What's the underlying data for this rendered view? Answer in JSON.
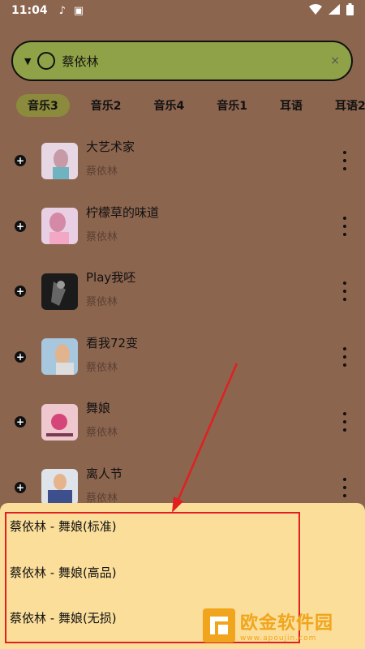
{
  "status_bar": {
    "time": "11:04"
  },
  "search": {
    "query": "蔡依林",
    "clear_icon": "×"
  },
  "tabs": [
    {
      "label": "音乐3",
      "active": true
    },
    {
      "label": "音乐2"
    },
    {
      "label": "音乐4"
    },
    {
      "label": "音乐1"
    },
    {
      "label": "耳语"
    },
    {
      "label": "耳语2"
    }
  ],
  "songs": [
    {
      "title": "大艺术家",
      "artist": "蔡依林",
      "cover_color": "#e7d6e4"
    },
    {
      "title": "柠檬草的味道",
      "artist": "蔡依林",
      "cover_color": "#e9cfe3"
    },
    {
      "title": "Play我呸",
      "artist": "蔡依林",
      "cover_color": "#1b1b1b"
    },
    {
      "title": "看我72变",
      "artist": "蔡依林",
      "cover_color": "#a7c7de"
    },
    {
      "title": "舞娘",
      "artist": "蔡依林",
      "cover_color": "#eec7cf"
    },
    {
      "title": "离人节",
      "artist": "蔡依林",
      "cover_color": "#3d4f8c"
    }
  ],
  "quality_sheet": {
    "options": [
      "蔡依林 - 舞娘(标准)",
      "蔡依林 - 舞娘(高品)",
      "蔡依林 - 舞娘(无损)"
    ]
  },
  "watermark": {
    "name": "欧金软件园",
    "url": "www.apoujin.com"
  },
  "colors": {
    "background": "#8c654f",
    "search_bar": "#8fa247",
    "active_tab": "#8c8a3c",
    "sheet": "#fbde9a",
    "annotation": "#e02020",
    "watermark": "#f0a51c"
  }
}
